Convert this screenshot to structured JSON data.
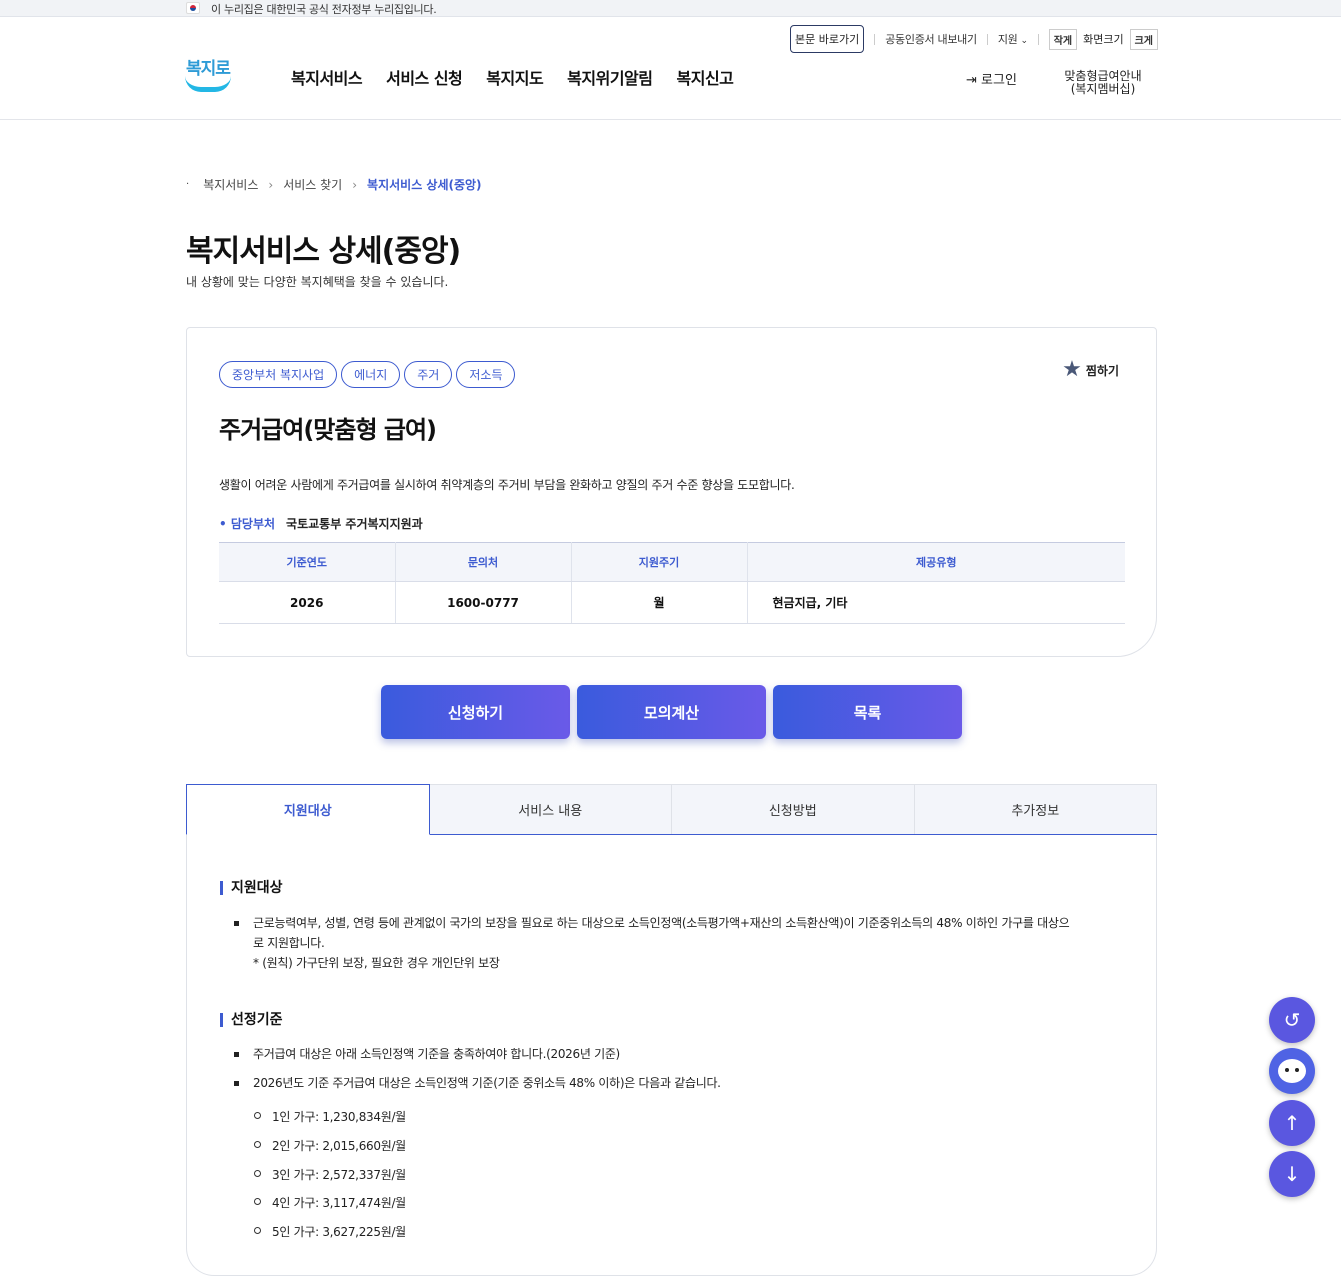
{
  "gov_bar": {
    "text": "이 누리집은 대한민국 공식 전자정부 누리집입니다."
  },
  "header": {
    "util": {
      "skip": "본문 바로가기",
      "cert": "공동인증서 내보내기",
      "support": "지원",
      "small": "작게",
      "font_size": "화면크기",
      "large": "크게"
    },
    "logo_text": "복지로",
    "gnb": [
      "복지서비스",
      "서비스 신청",
      "복지지도",
      "복지위기알림",
      "복지신고"
    ],
    "login": "로그인",
    "member": "맞춤형급여안내\n(복지멤버십)"
  },
  "breadcrumb": [
    "복지서비스",
    "서비스 찾기",
    "복지서비스 상세(중앙)"
  ],
  "page": {
    "title": "복지서비스 상세(중앙)",
    "desc": "내 상황에 맞는 다양한 복지혜택을 찾을 수 있습니다."
  },
  "card": {
    "tags": [
      "중앙부처 복지사업",
      "에너지",
      "주거",
      "저소득"
    ],
    "favorite": "찜하기",
    "title": "주거급여(맞춤형 급여)",
    "desc": "생활이 어려운 사람에게 주거급여를 실시하여 취약계층의 주거비 부담을 완화하고 양질의 주거 수준 향상을 도모합니다.",
    "dept_label": "담당부처",
    "dept_value": "국토교통부 주거복지지원과",
    "table_headers": [
      "기준연도",
      "문의처",
      "지원주기",
      "제공유형"
    ],
    "table_row": [
      "2026",
      "1600-0777",
      "월",
      "현금지급, 기타"
    ]
  },
  "actions": [
    "신청하기",
    "모의계산",
    "목록"
  ],
  "tabs": [
    "지원대상",
    "서비스 내용",
    "신청방법",
    "추가정보"
  ],
  "content": {
    "sec1_title": "지원대상",
    "sec1_item1_line1": "근로능력여부, 성별, 연령 등에 관계없이 국가의 보장을 필요로 하는 대상으로 소득인정액(소득평가액+재산의 소득환산액)이 기준중위소득의 48% 이하인 가구를 대상으",
    "sec1_item1_line2": "로 지원합니다.",
    "sec1_item1_note": "* (원칙) 가구단위 보장, 필요한 경우 개인단위 보장",
    "sec2_title": "선정기준",
    "sec2_item1": "주거급여 대상은 아래 소득인정액 기준을 충족하여야 합니다.(2026년 기준)",
    "sec2_item2": "2026년도 기준 주거급여 대상은 소득인정액 기준(기준 중위소득 48% 이하)은 다음과 같습니다.",
    "sec2_sub": [
      "1인 가구: 1,230,834원/월",
      "2인 가구: 2,015,660원/월",
      "3인 가구: 2,572,337원/월",
      "4인 가구: 3,117,474원/월",
      "5인 가구: 3,627,225원/월"
    ]
  },
  "floating": [
    "history-icon",
    "chatbot-icon",
    "arrow-up-icon",
    "arrow-down-icon"
  ]
}
